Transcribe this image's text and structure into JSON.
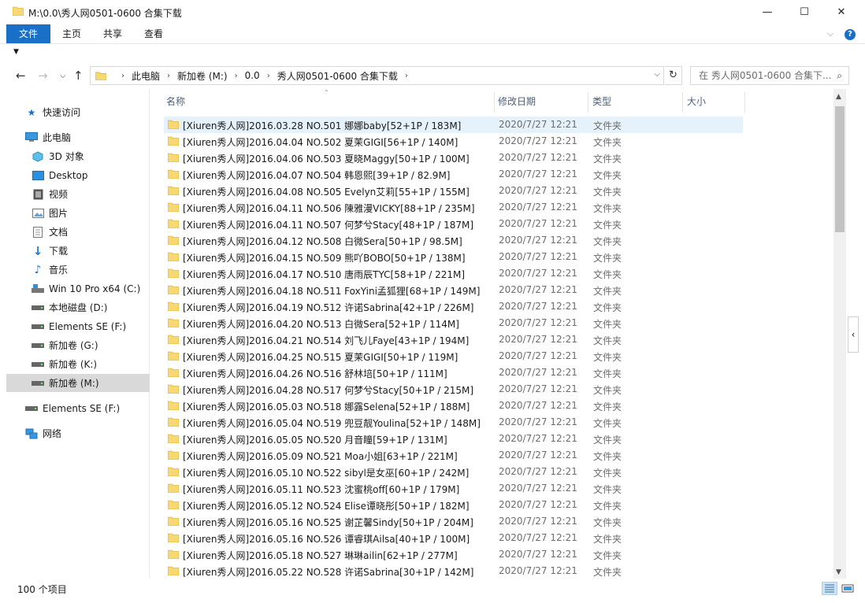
{
  "window": {
    "title": "M:\\0.0\\秀人网0501-0600 合集下载",
    "min": "—",
    "max": "☐",
    "close": "✕"
  },
  "ribbon": {
    "file": "文件",
    "tabs": [
      "主页",
      "共享",
      "查看"
    ]
  },
  "address": {
    "crumbs": [
      "此电脑",
      "新加卷 (M:)",
      "0.0",
      "秀人网0501-0600 合集下载"
    ],
    "search_placeholder": "在 秀人网0501-0600 合集下..."
  },
  "sidebar": {
    "items": [
      {
        "label": "快速访问",
        "icon": "star-icon"
      },
      {
        "label": "此电脑",
        "icon": "computer-icon"
      },
      {
        "label": "3D 对象",
        "icon": "cube-icon"
      },
      {
        "label": "Desktop",
        "icon": "desktop-icon"
      },
      {
        "label": "视频",
        "icon": "video-icon"
      },
      {
        "label": "图片",
        "icon": "picture-icon"
      },
      {
        "label": "文档",
        "icon": "document-icon"
      },
      {
        "label": "下载",
        "icon": "download-icon"
      },
      {
        "label": "音乐",
        "icon": "music-icon"
      },
      {
        "label": "Win 10 Pro x64 (C:)",
        "icon": "drive-icon"
      },
      {
        "label": "本地磁盘 (D:)",
        "icon": "drive-icon"
      },
      {
        "label": "Elements SE (F:)",
        "icon": "drive-icon"
      },
      {
        "label": "新加卷 (G:)",
        "icon": "drive-icon"
      },
      {
        "label": "新加卷 (K:)",
        "icon": "drive-icon"
      },
      {
        "label": "新加卷 (M:)",
        "icon": "drive-icon"
      },
      {
        "label": "Elements SE (F:)",
        "icon": "drive-icon"
      },
      {
        "label": "网络",
        "icon": "network-icon"
      }
    ]
  },
  "columns": {
    "name": "名称",
    "date": "修改日期",
    "type": "类型",
    "size": "大小"
  },
  "files": [
    {
      "name": "[Xiuren秀人网]2016.03.28 NO.501 娜娜baby[52+1P / 183M]",
      "date": "2020/7/27 12:21",
      "type": "文件夹"
    },
    {
      "name": "[Xiuren秀人网]2016.04.04 NO.502 夏茉GIGI[56+1P / 140M]",
      "date": "2020/7/27 12:21",
      "type": "文件夹"
    },
    {
      "name": "[Xiuren秀人网]2016.04.06 NO.503 夏晓Maggy[50+1P / 100M]",
      "date": "2020/7/27 12:21",
      "type": "文件夹"
    },
    {
      "name": "[Xiuren秀人网]2016.04.07 NO.504 韩恩熙[39+1P / 82.9M]",
      "date": "2020/7/27 12:21",
      "type": "文件夹"
    },
    {
      "name": "[Xiuren秀人网]2016.04.08 NO.505 Evelyn艾莉[55+1P / 155M]",
      "date": "2020/7/27 12:21",
      "type": "文件夹"
    },
    {
      "name": "[Xiuren秀人网]2016.04.11 NO.506 陳雅漫VICKY[88+1P / 235M]",
      "date": "2020/7/27 12:21",
      "type": "文件夹"
    },
    {
      "name": "[Xiuren秀人网]2016.04.11 NO.507 何梦兮Stacy[48+1P / 187M]",
      "date": "2020/7/27 12:21",
      "type": "文件夹"
    },
    {
      "name": "[Xiuren秀人网]2016.04.12 NO.508 白微Sera[50+1P / 98.5M]",
      "date": "2020/7/27 12:21",
      "type": "文件夹"
    },
    {
      "name": "[Xiuren秀人网]2016.04.15 NO.509 熊吖BOBO[50+1P / 138M]",
      "date": "2020/7/27 12:21",
      "type": "文件夹"
    },
    {
      "name": "[Xiuren秀人网]2016.04.17 NO.510 唐雨辰TYC[58+1P / 221M]",
      "date": "2020/7/27 12:21",
      "type": "文件夹"
    },
    {
      "name": "[Xiuren秀人网]2016.04.18 NO.511 FoxYini孟狐狸[68+1P / 149M]",
      "date": "2020/7/27 12:21",
      "type": "文件夹"
    },
    {
      "name": "[Xiuren秀人网]2016.04.19 NO.512 许诺Sabrina[42+1P / 226M]",
      "date": "2020/7/27 12:21",
      "type": "文件夹"
    },
    {
      "name": "[Xiuren秀人网]2016.04.20 NO.513 白微Sera[52+1P / 114M]",
      "date": "2020/7/27 12:21",
      "type": "文件夹"
    },
    {
      "name": "[Xiuren秀人网]2016.04.21 NO.514 刘飞儿Faye[43+1P / 194M]",
      "date": "2020/7/27 12:21",
      "type": "文件夹"
    },
    {
      "name": "[Xiuren秀人网]2016.04.25 NO.515 夏茉GIGI[50+1P / 119M]",
      "date": "2020/7/27 12:21",
      "type": "文件夹"
    },
    {
      "name": "[Xiuren秀人网]2016.04.26 NO.516 舒林培[50+1P / 111M]",
      "date": "2020/7/27 12:21",
      "type": "文件夹"
    },
    {
      "name": "[Xiuren秀人网]2016.04.28 NO.517 何梦兮Stacy[50+1P / 215M]",
      "date": "2020/7/27 12:21",
      "type": "文件夹"
    },
    {
      "name": "[Xiuren秀人网]2016.05.03 NO.518 娜露Selena[52+1P / 188M]",
      "date": "2020/7/27 12:21",
      "type": "文件夹"
    },
    {
      "name": "[Xiuren秀人网]2016.05.04 NO.519 兜豆靓Youlina[52+1P / 148M]",
      "date": "2020/7/27 12:21",
      "type": "文件夹"
    },
    {
      "name": "[Xiuren秀人网]2016.05.05 NO.520 月音瞳[59+1P / 131M]",
      "date": "2020/7/27 12:21",
      "type": "文件夹"
    },
    {
      "name": "[Xiuren秀人网]2016.05.09 NO.521 Moa小姐[63+1P / 221M]",
      "date": "2020/7/27 12:21",
      "type": "文件夹"
    },
    {
      "name": "[Xiuren秀人网]2016.05.10 NO.522 sibyl是女巫[60+1P / 242M]",
      "date": "2020/7/27 12:21",
      "type": "文件夹"
    },
    {
      "name": "[Xiuren秀人网]2016.05.11 NO.523 沈蜜桃off[60+1P / 179M]",
      "date": "2020/7/27 12:21",
      "type": "文件夹"
    },
    {
      "name": "[Xiuren秀人网]2016.05.12 NO.524 Elise谭晓彤[50+1P / 182M]",
      "date": "2020/7/27 12:21",
      "type": "文件夹"
    },
    {
      "name": "[Xiuren秀人网]2016.05.16 NO.525 谢芷馨Sindy[50+1P / 204M]",
      "date": "2020/7/27 12:21",
      "type": "文件夹"
    },
    {
      "name": "[Xiuren秀人网]2016.05.16 NO.526 谭睿琪Ailsa[40+1P / 100M]",
      "date": "2020/7/27 12:21",
      "type": "文件夹"
    },
    {
      "name": "[Xiuren秀人网]2016.05.18 NO.527 琳琳ailin[62+1P / 277M]",
      "date": "2020/7/27 12:21",
      "type": "文件夹"
    },
    {
      "name": "[Xiuren秀人网]2016.05.22 NO.528 许诺Sabrina[30+1P / 142M]",
      "date": "2020/7/27 12:21",
      "type": "文件夹"
    }
  ],
  "status": {
    "count": "100 个项目"
  },
  "colors": {
    "accent": "#1a6fc6",
    "selected_row": "#e5f1fb",
    "folder": "#f8d775"
  }
}
